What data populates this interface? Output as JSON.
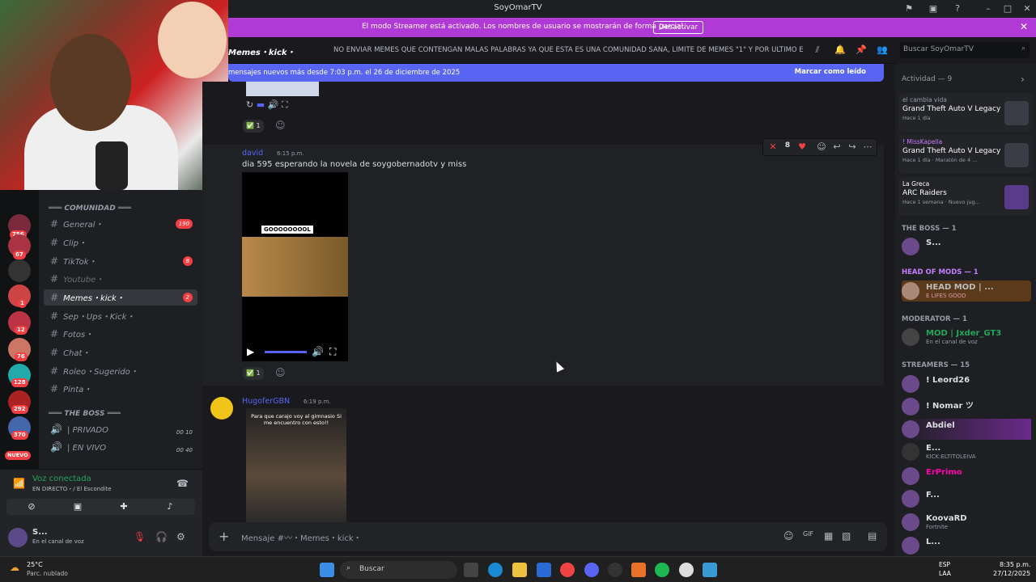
{
  "window": {
    "title": "SoyOmarTV"
  },
  "streamer_bar": {
    "text": "El modo Streamer está activado. Los nombres de usuario se mostrarán de forma parcial.",
    "button": "Desactivar",
    "close": "✕"
  },
  "header": {
    "channel": "Memes・kick・",
    "topic": "NO ENVIAR MEMES QUE CONTENGAN MALAS PALABRAS YA QUE ESTA ES UNA COMUNIDAD SANA, LIMITE DE MEMES \"1\" Y POR ULTIMO E...",
    "search_placeholder": "Buscar SoyOmarTV"
  },
  "new_messages": {
    "text": "mensajes nuevos más desde 7:03 p.m. el 26 de diciembre de 2025",
    "action": "Marcar como leído"
  },
  "servers": [
    {
      "badge": "756"
    },
    {
      "badge": "67"
    },
    {
      "badge": ""
    },
    {
      "badge": "1"
    },
    {
      "badge": "12"
    },
    {
      "badge": "76"
    },
    {
      "badge": "128"
    },
    {
      "badge": "292"
    },
    {
      "badge": "370"
    }
  ],
  "servers_new": "NUEVO",
  "channels": {
    "category1": "═══ COMUNIDAD ═══",
    "items": [
      {
        "label": "General・",
        "badge": "190"
      },
      {
        "label": "Clip・",
        "badge": ""
      },
      {
        "label": "TikTok・",
        "badge": "8"
      },
      {
        "label": "Youtube・",
        "badge": ""
      },
      {
        "label": "Memes・kick・",
        "badge": "2"
      },
      {
        "label": "Sep・Ups・Kick・",
        "badge": ""
      },
      {
        "label": "Fotos・",
        "badge": ""
      },
      {
        "label": "Chat・",
        "badge": ""
      },
      {
        "label": "Roleo・Sugerido・",
        "badge": ""
      },
      {
        "label": "Pinta・",
        "badge": ""
      }
    ],
    "category2": "═══ THE BOSS ═══",
    "voice": [
      {
        "label": "| PRIVADO",
        "c1": "00",
        "c2": "10"
      },
      {
        "label": "| EN VIVO",
        "c1": "00",
        "c2": "40"
      }
    ]
  },
  "voice_panel": {
    "status": "Voz conectada",
    "detail": "EN DIRECTO・/ El Escondite",
    "user": "S...",
    "user_status": "En el canal de voz"
  },
  "messages": [
    {
      "reaction_count": "1"
    },
    {
      "author": "david",
      "time": "6:15 p.m.",
      "text": "dia 595 esperando la novela de soygobernadotv y miss",
      "overlay": "GOOOOOOOOL",
      "reaction_count": "1"
    },
    {
      "author": "HugoferGBN",
      "time": "6:19 p.m.",
      "overlay": "Para que carajo voy al gimnasio Si me encuentro con esto!!"
    }
  ],
  "toolbar": {
    "count": "8"
  },
  "composer": {
    "placeholder": "Mensaje #〰・Memes・kick・"
  },
  "members": {
    "activity_title": "Actividad — 9",
    "activities": [
      {
        "user": "el cambia vida",
        "game": "Grand Theft Auto V Legacy",
        "meta": "Hace 1 día"
      },
      {
        "user": "! MissKapella",
        "game": "Grand Theft Auto V Legacy",
        "meta": "Hace 1 día · Maratón de 4 ..."
      },
      {
        "user": "La Greca",
        "game": "ARC Raiders",
        "meta": "Hace 1 semana · Nuevo jug..."
      }
    ],
    "groups": [
      {
        "role": "THE BOSS — 1",
        "members": [
          {
            "name": "S...",
            "sub": ""
          }
        ]
      },
      {
        "role": "HEAD OF MODS — 1",
        "members": [
          {
            "name": "HEAD MOD | ...",
            "sub": "E LIFES GOOD"
          }
        ]
      },
      {
        "role": "MODERATOR — 1",
        "members": [
          {
            "name": "MOD | Jxder_GT3",
            "sub": "En el canal de voz"
          }
        ]
      },
      {
        "role": "STREAMERS — 15",
        "members": [
          {
            "name": "! Leord26",
            "sub": ""
          },
          {
            "name": "! Nomar ツ",
            "sub": ""
          },
          {
            "name": "Abdiel",
            "sub": ""
          },
          {
            "name": "E...",
            "sub": "KICK:ELTITOLEIVA"
          },
          {
            "name": "ErPrimo",
            "sub": ""
          },
          {
            "name": "F...",
            "sub": ""
          },
          {
            "name": "KoovaRD",
            "sub": "Fortnite"
          },
          {
            "name": "L...",
            "sub": ""
          }
        ]
      }
    ]
  },
  "taskbar": {
    "weather_temp": "25°C",
    "weather_desc": "Parc. nublado",
    "search": "Buscar",
    "lang": "ESP",
    "lang2": "LAA",
    "time": "8:35 p.m.",
    "date": "27/12/2025"
  },
  "colors": {
    "accent": "#5865f2",
    "streamer": "#b03ad6",
    "badge": "#f23f43"
  }
}
